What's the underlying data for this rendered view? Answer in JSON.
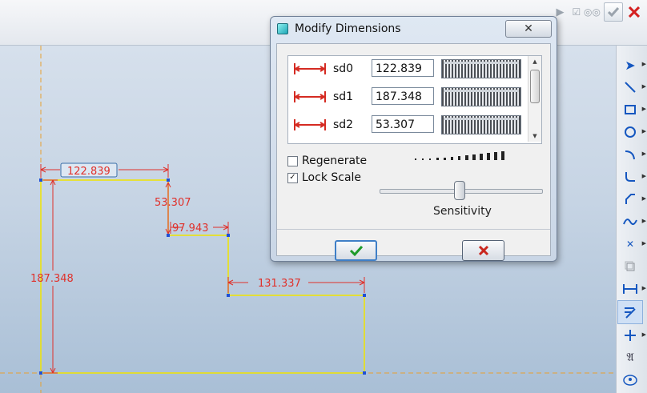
{
  "toolbar": {
    "icons": [
      "arrow-icon",
      "checkbox-eyeglasses-icon",
      "checkmark-icon",
      "close-icon"
    ]
  },
  "sketch": {
    "dimensions": [
      "122.839",
      "53.307",
      "97.943",
      "131.337",
      "187.348"
    ]
  },
  "dialog": {
    "title": "Modify Dimensions",
    "close_label": "✕",
    "dimensions": [
      {
        "name": "sd0",
        "value": "122.839"
      },
      {
        "name": "sd1",
        "value": "187.348"
      },
      {
        "name": "sd2",
        "value": "53.307"
      }
    ],
    "regenerate_label": "Regenerate",
    "regenerate_checked": false,
    "lock_scale_label": "Lock Scale",
    "lock_scale_checked": true,
    "sensitivity_label": "Sensitivity",
    "ok_icon": "green-check-icon",
    "cancel_icon": "red-x-icon"
  },
  "right_toolbar": {
    "tools": [
      "select-arrow-icon",
      "line-icon",
      "rectangle-icon",
      "circle-icon",
      "arc-icon",
      "fillet-icon",
      "chamfer-icon",
      "spline-icon",
      "point-icon",
      "offset-icon",
      "dimension-icon",
      "modify-icon",
      "constraint-icon",
      "text-icon",
      "palette-icon"
    ]
  },
  "colors": {
    "dimension": "#e0302a",
    "geometry": "#f0e400",
    "vertex": "#1f4fd6",
    "axis": "#e8a030"
  }
}
